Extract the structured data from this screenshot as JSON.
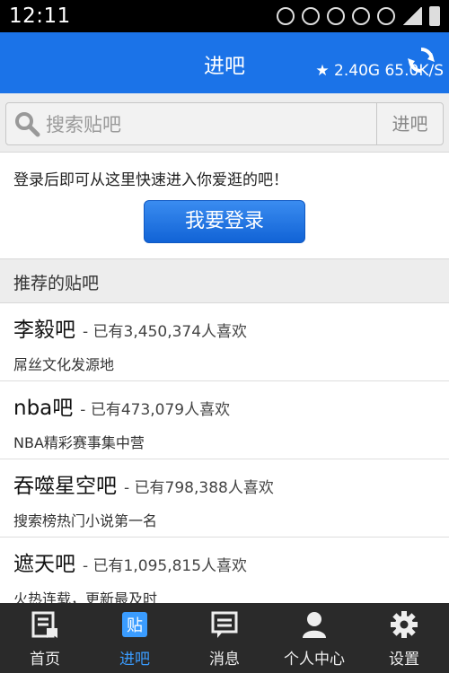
{
  "statusbar": {
    "time": "12:11"
  },
  "titlebar": {
    "title": "进吧",
    "speed": "★ 2.40G  65.0K/S"
  },
  "search": {
    "placeholder": "搜索贴吧",
    "button": "进吧"
  },
  "login": {
    "hint": "登录后即可从这里快速进入你爱逛的吧！",
    "button": "我要登录"
  },
  "recommended": {
    "header": "推荐的贴吧",
    "items": [
      {
        "name": "李毅吧",
        "count": "- 已有3,450,374人喜欢",
        "desc": "屌丝文化发源地"
      },
      {
        "name": "nba吧",
        "count": "- 已有473,079人喜欢",
        "desc": "NBA精彩赛事集中营"
      },
      {
        "name": "吞噬星空吧",
        "count": "- 已有798,388人喜欢",
        "desc": "搜索榜热门小说第一名"
      },
      {
        "name": "遮天吧",
        "count": "- 已有1,095,815人喜欢",
        "desc": "火热连载，更新最及时"
      }
    ]
  },
  "tabs": [
    {
      "label": "首页",
      "icon": "home-icon"
    },
    {
      "label": "进吧",
      "icon": "enter-bar-icon",
      "active": true
    },
    {
      "label": "消息",
      "icon": "message-icon"
    },
    {
      "label": "个人中心",
      "icon": "person-icon"
    },
    {
      "label": "设置",
      "icon": "gear-icon"
    }
  ],
  "colors": {
    "accent": "#1b73e8",
    "tab_active": "#3a9cff",
    "tabbar": "#2a2a2a"
  }
}
